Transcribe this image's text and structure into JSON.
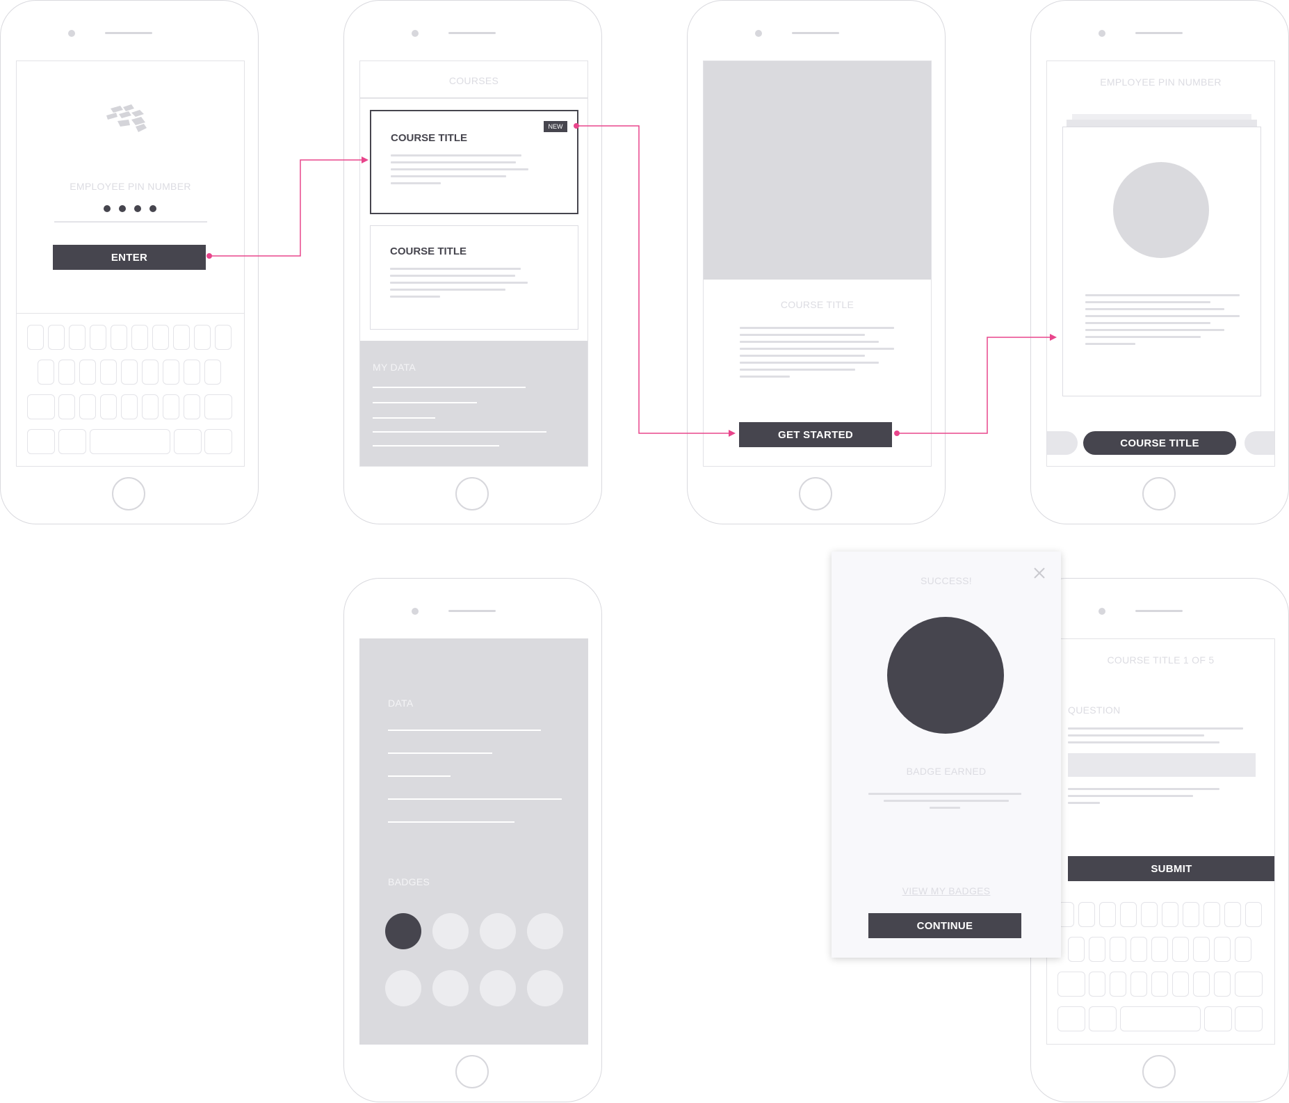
{
  "screen1": {
    "pin_label": "EMPLOYEE PIN NUMBER",
    "pin_dots": "●●●●",
    "enter_label": "ENTER"
  },
  "screen2": {
    "header": "COURSES",
    "card1_title": "COURSE TITLE",
    "card1_badge": "NEW",
    "card2_title": "COURSE TITLE",
    "my_data_label": "MY DATA"
  },
  "screen3": {
    "course_title": "COURSE TITLE",
    "get_started_label": "GET STARTED"
  },
  "screen4": {
    "pin_label": "EMPLOYEE PIN NUMBER",
    "course_title_button": "COURSE TITLE"
  },
  "screen5": {
    "data_label": "DATA",
    "badges_label": "BADGES"
  },
  "modal": {
    "success_label": "SUCCESS!",
    "badge_earned_label": "BADGE EARNED",
    "view_badges_link": "VIEW MY BADGES",
    "continue_label": "CONTINUE",
    "close_icon": "close-icon"
  },
  "screen6": {
    "progress_title": "COURSE TITLE 1 OF 5",
    "question_label": "QUESTION",
    "submit_label": "SUBMIT"
  },
  "colors": {
    "dark": "#46454e",
    "accent_flow": "#e8458b",
    "placeholder": "#d9d9de"
  }
}
